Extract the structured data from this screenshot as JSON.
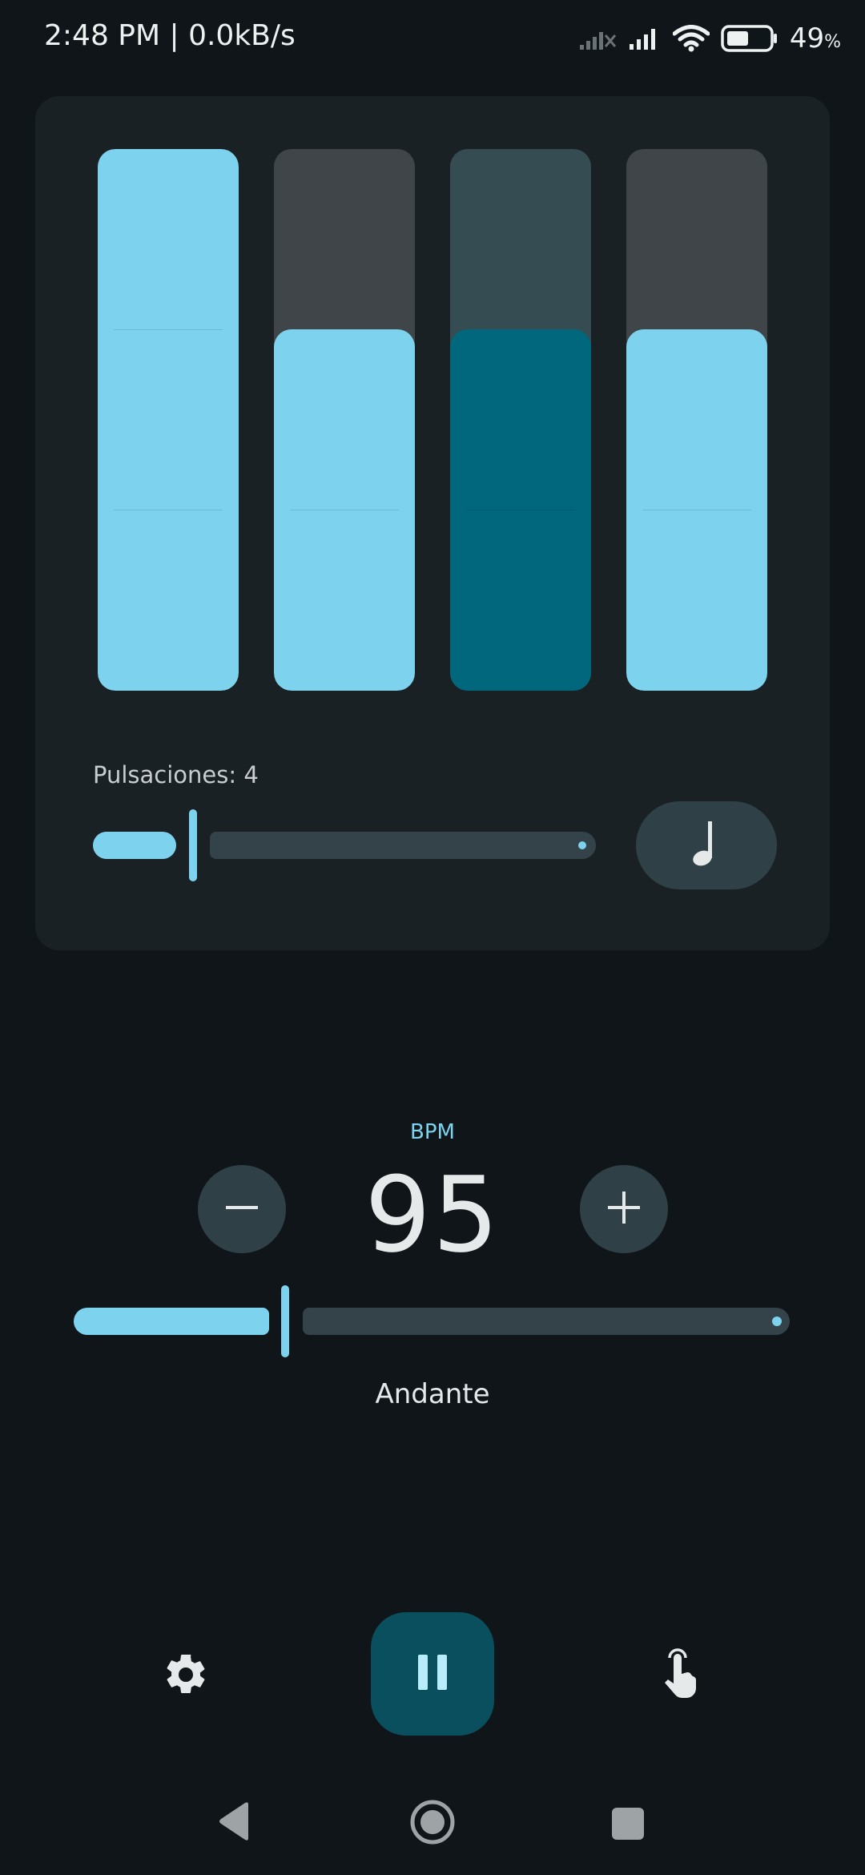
{
  "status_bar": {
    "time": "2:48 PM | 0.0kB/s",
    "battery_percent": "49",
    "battery_unit": "%",
    "battery_level": 0.49,
    "icons": [
      "signal-off-icon",
      "signal-icon",
      "wifi-icon",
      "battery-icon"
    ]
  },
  "beats": {
    "label": "Pulsaciones: 4",
    "count": 4,
    "slider_value": 4,
    "bars": [
      {
        "level": 1.0,
        "accent": "full"
      },
      {
        "level": 0.667,
        "accent": "normal"
      },
      {
        "level": 0.667,
        "accent": "muted"
      },
      {
        "level": 0.667,
        "accent": "normal"
      }
    ],
    "subdivision_icon": "quarter-note-icon"
  },
  "tempo": {
    "bpm_label": "BPM",
    "bpm": "95",
    "name": "Andante",
    "decrease_icon": "minus-icon",
    "increase_icon": "plus-icon"
  },
  "controls": {
    "settings_icon": "gear-icon",
    "play_state_icon": "pause-icon",
    "tap_icon": "tap-hand-icon"
  },
  "navigation": {
    "icons": [
      "back-icon",
      "home-icon",
      "recents-icon"
    ]
  },
  "colors": {
    "background": "#0f1519",
    "card": "#1a2125",
    "accent": "#7dd3ee",
    "accent_dark": "#00677d",
    "track_gray": "#3f4548",
    "track_teal": "#344c52",
    "button_bg": "#2f4147",
    "play_bg": "#0a4f5d"
  }
}
